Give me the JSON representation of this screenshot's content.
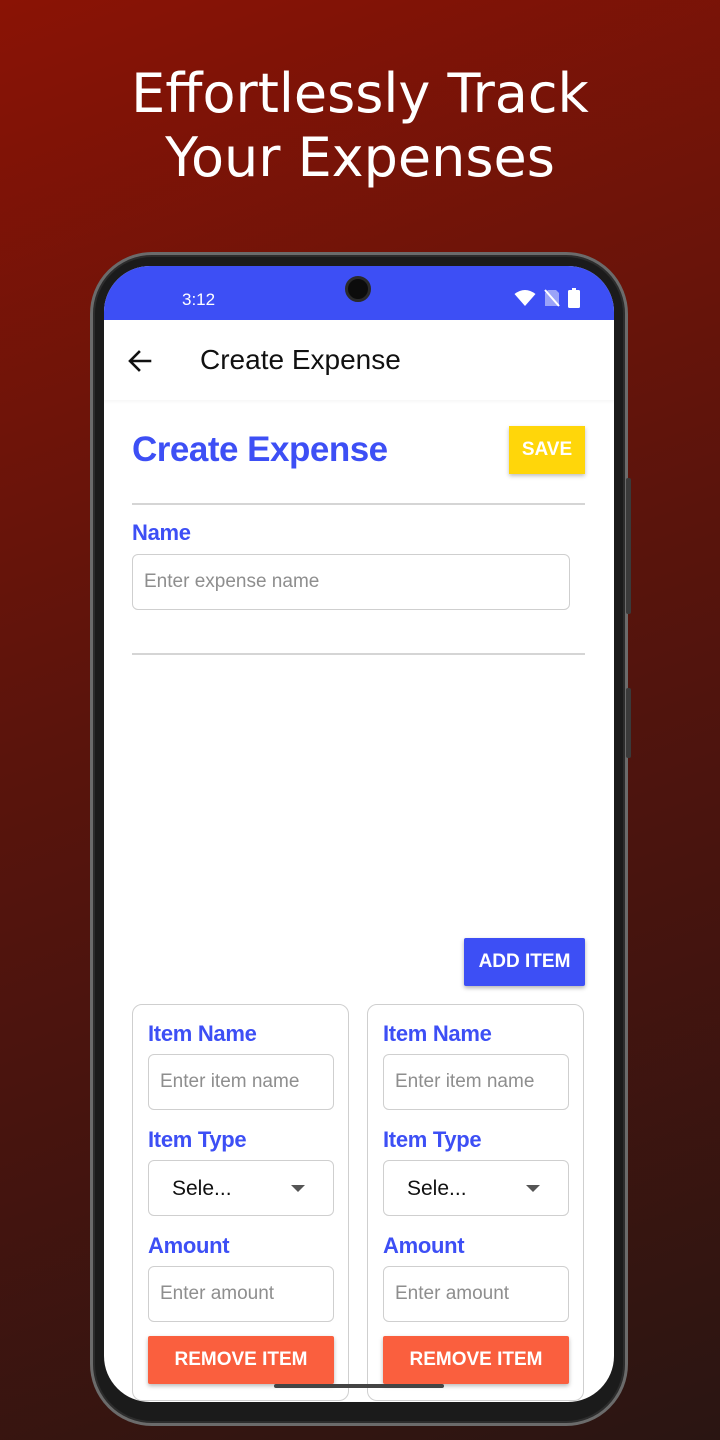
{
  "promo": {
    "headline_line1": "Effortlessly Track",
    "headline_line2": "Your Expenses"
  },
  "status_bar": {
    "time": "3:12",
    "icons": [
      "wifi-icon",
      "no-sim-icon",
      "battery-icon"
    ]
  },
  "app_bar": {
    "back_icon": "arrow-left-icon",
    "title": "Create Expense"
  },
  "form": {
    "title": "Create Expense",
    "save_label": "SAVE",
    "name_label": "Name",
    "name_placeholder": "Enter expense name",
    "add_item_label": "ADD ITEM",
    "items": [
      {
        "name_label": "Item Name",
        "name_placeholder": "Enter item name",
        "type_label": "Item Type",
        "type_value": "Sele...",
        "amount_label": "Amount",
        "amount_placeholder": "Enter amount",
        "remove_label": "REMOVE ITEM"
      },
      {
        "name_label": "Item Name",
        "name_placeholder": "Enter item name",
        "type_label": "Item Type",
        "type_value": "Sele...",
        "amount_label": "Amount",
        "amount_placeholder": "Enter amount",
        "remove_label": "REMOVE ITEM"
      }
    ]
  },
  "colors": {
    "primary": "#3d4ff5",
    "save": "#ffd60a",
    "remove": "#fa5f3e",
    "background_top": "#8a1305",
    "background_bottom": "#2a1512"
  }
}
